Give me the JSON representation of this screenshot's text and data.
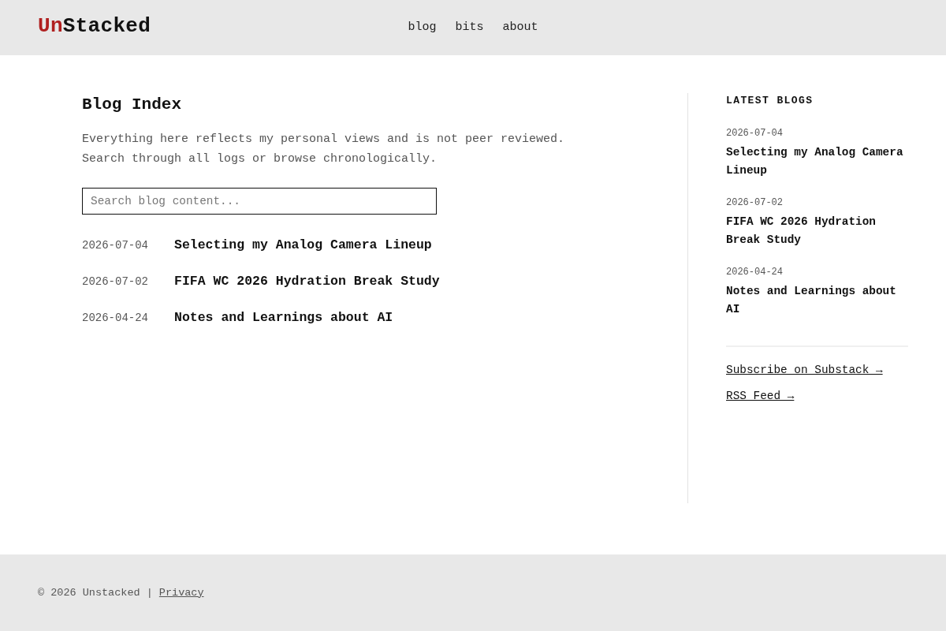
{
  "header": {
    "logo": {
      "accent": "Un",
      "text": "Stacked"
    },
    "nav": [
      {
        "label": "blog"
      },
      {
        "label": "bits"
      },
      {
        "label": "about"
      }
    ]
  },
  "main": {
    "title": "Blog Index",
    "intro": [
      "Everything here reflects my personal views and is not peer reviewed.",
      "Search through all logs or browse chronologically."
    ],
    "search": {
      "placeholder": "Search blog content..."
    },
    "posts": [
      {
        "date": "2026-07-04",
        "title": "Selecting my Analog Camera Lineup"
      },
      {
        "date": "2026-07-02",
        "title": "FIFA WC 2026 Hydration Break Study"
      },
      {
        "date": "2026-04-24",
        "title": "Notes and Learnings about AI"
      }
    ]
  },
  "sidebar": {
    "heading": "LATEST BLOGS",
    "posts": [
      {
        "date": "2026-07-04",
        "title": "Selecting my Analog Camera Lineup"
      },
      {
        "date": "2026-07-02",
        "title": "FIFA WC 2026 Hydration Break Study"
      },
      {
        "date": "2026-04-24",
        "title": "Notes and Learnings about AI"
      }
    ],
    "links": [
      "Subscribe on Substack →",
      "RSS Feed →"
    ]
  },
  "footer": {
    "copyright": "© 2026 Unstacked |",
    "link": "Privacy"
  }
}
